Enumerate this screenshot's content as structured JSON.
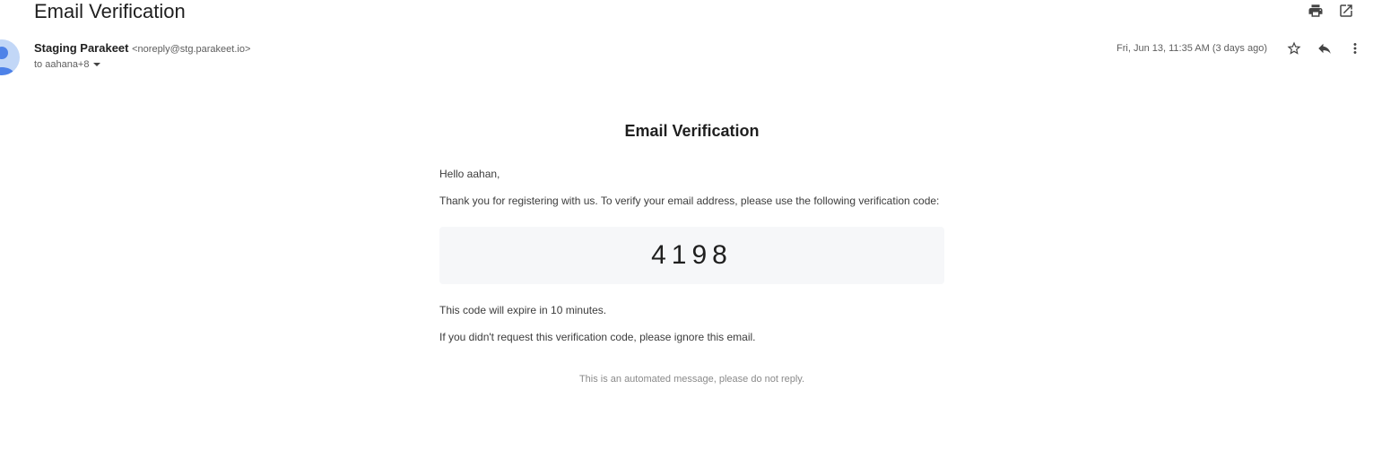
{
  "header": {
    "subject": "Email Verification"
  },
  "sender": {
    "name": "Staging Parakeet",
    "email": "<noreply@stg.parakeet.io>",
    "to": "to aahana+8",
    "date": "Fri, Jun 13, 11:35 AM (3 days ago)"
  },
  "icons": {
    "print": "print-icon",
    "open_new_window": "open-in-new-window-icon",
    "star": "star-icon",
    "reply": "reply-icon",
    "more": "more-vert-icon",
    "dropdown": "chevron-down-icon",
    "avatar": "person-avatar-icon"
  },
  "colors": {
    "avatar_bg": "#c2d7f7",
    "avatar_fg": "#4e82e8",
    "code_box_bg": "#f6f7f9"
  },
  "email": {
    "title": "Email Verification",
    "greeting": "Hello aahan,",
    "intro": "Thank you for registering with us. To verify your email address, please use the following verification code:",
    "code": "4198",
    "expiry": "This code will expire in 10 minutes.",
    "ignore_note": "If you didn't request this verification code, please ignore this email.",
    "footer": "This is an automated message, please do not reply."
  }
}
